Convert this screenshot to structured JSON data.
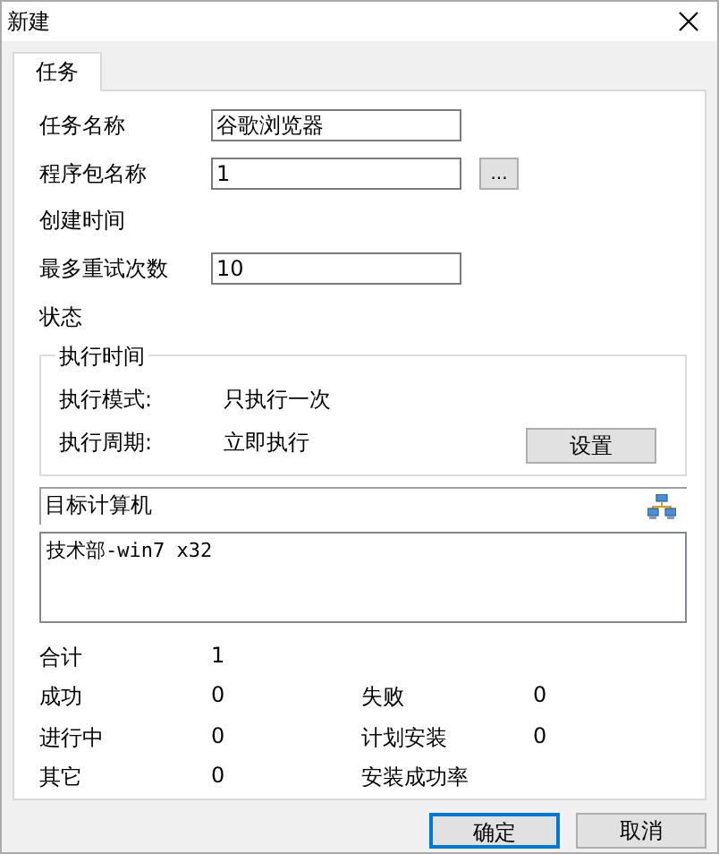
{
  "window": {
    "title": "新建"
  },
  "tabs": [
    {
      "label": "任务",
      "selected": true
    }
  ],
  "fields": [
    {
      "kind": "input",
      "label": "任务名称",
      "value": "谷歌浏览器"
    },
    {
      "kind": "browse",
      "label": "程序包名称",
      "value": "1",
      "button": "..."
    },
    {
      "kind": "label",
      "label": "创建时间"
    },
    {
      "kind": "input",
      "label": "最多重试次数",
      "value": "10"
    },
    {
      "kind": "label",
      "label": "状态"
    }
  ],
  "schedule": {
    "title": "执行时间",
    "rows": [
      {
        "label": "执行模式:",
        "value": "只执行一次"
      },
      {
        "label": "执行周期:",
        "value": "立即执行"
      }
    ],
    "button": "设置"
  },
  "targets": {
    "title": "目标计算机",
    "items": [
      "技术部-win7 x32"
    ]
  },
  "stats": [
    [
      {
        "label": "合计",
        "value": "1"
      }
    ],
    [
      {
        "label": "成功",
        "value": "0"
      },
      {
        "label": "失败",
        "value": "0"
      }
    ],
    [
      {
        "label": "进行中",
        "value": "0"
      },
      {
        "label": "计划安装",
        "value": "0"
      }
    ],
    [
      {
        "label": "其它",
        "value": "0"
      },
      {
        "label": "安装成功率"
      }
    ]
  ],
  "buttons": [
    {
      "label": "确定",
      "default": true
    },
    {
      "label": "取消",
      "default": false
    }
  ]
}
